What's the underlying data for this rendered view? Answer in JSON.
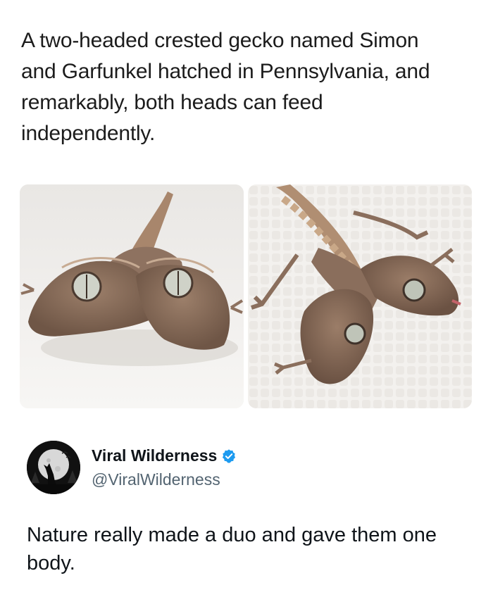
{
  "headline": "A two-headed crested gecko named Simon and Garfunkel hatched in Pennsylvania, and remarkably, both heads can feed independently.",
  "photos": {
    "left": {
      "icon": "gecko-photo-front"
    },
    "right": {
      "icon": "gecko-photo-top"
    }
  },
  "account": {
    "display_name": "Viral Wilderness",
    "handle": "@ViralWilderness",
    "verified": true,
    "avatar_icon": "wolf-howling-moon-logo",
    "verified_icon": "verified-badge-icon",
    "verified_color": "#1d9bf0"
  },
  "tweet": {
    "text": "Nature really made a duo and gave them one body."
  }
}
